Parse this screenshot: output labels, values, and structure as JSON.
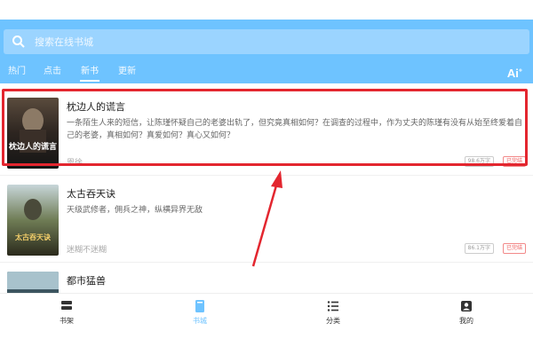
{
  "search": {
    "placeholder": "搜索在线书城",
    "icon": "search-icon"
  },
  "tabs": [
    {
      "label": "热门"
    },
    {
      "label": "点击"
    },
    {
      "label": "新书",
      "active": true
    },
    {
      "label": "更新"
    }
  ],
  "ai_label": "Ai",
  "books": [
    {
      "title": "枕边人的谎言",
      "description": "一条陌生人来的短信，让陈瑾怀疑自己的老婆出轨了，但究竟真相如何？在调查的过程中，作为丈夫的陈瑾有没有从始至终爱着自己的老婆，真相如何？真爱如何？真心又如何？",
      "author": "恩徐",
      "words": "98.6万字",
      "status": "已完结",
      "cover_text": "枕边人的谎言"
    },
    {
      "title": "太古吞天诀",
      "description": "天级武修者，佣兵之神，纵横异界无敌",
      "author": "迷糊不迷糊",
      "words": "86.1万字",
      "status": "已完结",
      "cover_text": "太古吞天诀"
    },
    {
      "title": "都市猛兽",
      "description": "",
      "author": "",
      "words": "",
      "status": ""
    }
  ],
  "tabbar": [
    {
      "label": "书架",
      "icon": "bookshelf-icon"
    },
    {
      "label": "书城",
      "icon": "bookstore-icon",
      "active": true
    },
    {
      "label": "分类",
      "icon": "category-list-icon"
    },
    {
      "label": "我的",
      "icon": "profile-icon"
    }
  ],
  "colors": {
    "header": "#6ec3ff",
    "accent": "#6ec3ff",
    "highlight": "#e3262f",
    "status": "#ef5b5b"
  }
}
